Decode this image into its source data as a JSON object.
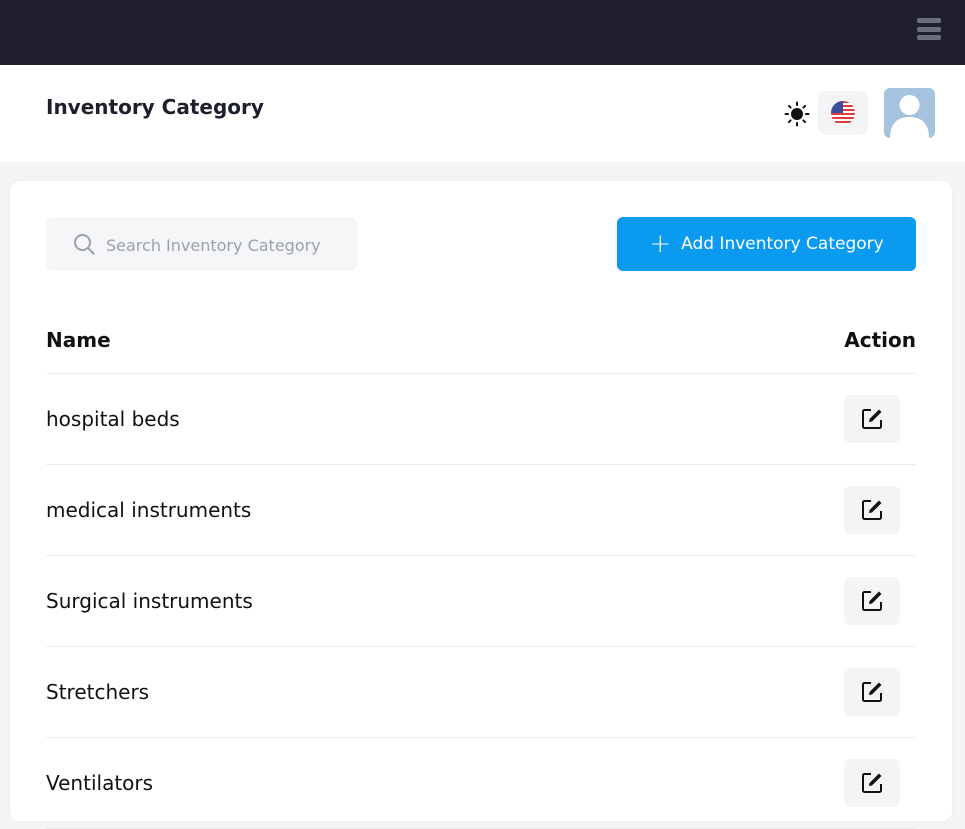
{
  "header": {
    "title": "Inventory Category",
    "language": "English (US)"
  },
  "search": {
    "placeholder": "Search Inventory Category"
  },
  "toolbar": {
    "add_label": "Add Inventory Category"
  },
  "table": {
    "columns": [
      "Name",
      "Action"
    ],
    "rows": [
      {
        "name": "hospital beds"
      },
      {
        "name": "medical instruments"
      },
      {
        "name": "Surgical instruments"
      },
      {
        "name": "Stretchers"
      },
      {
        "name": "Ventilators"
      }
    ]
  },
  "icons": {
    "menu": "hamburger-menu-icon",
    "theme": "sun-icon",
    "language": "us-flag-icon",
    "avatar": "user-avatar-icon",
    "search": "search-icon",
    "add": "plus-icon",
    "edit": "edit-icon"
  },
  "colors": {
    "topbar": "#1f1f2e",
    "accent": "#0a9bf0",
    "background": "#f4f5f7"
  }
}
